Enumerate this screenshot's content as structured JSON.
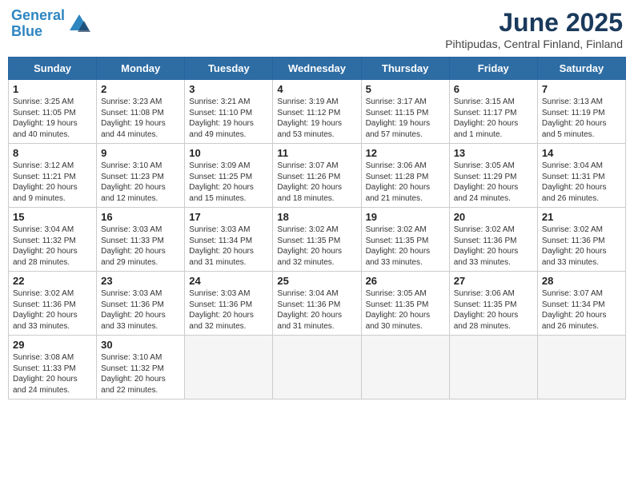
{
  "header": {
    "logo_line1": "General",
    "logo_line2": "Blue",
    "month_title": "June 2025",
    "subtitle": "Pihtipudas, Central Finland, Finland"
  },
  "weekdays": [
    "Sunday",
    "Monday",
    "Tuesday",
    "Wednesday",
    "Thursday",
    "Friday",
    "Saturday"
  ],
  "weeks": [
    [
      {
        "day": "1",
        "info": "Sunrise: 3:25 AM\nSunset: 11:05 PM\nDaylight: 19 hours\nand 40 minutes."
      },
      {
        "day": "2",
        "info": "Sunrise: 3:23 AM\nSunset: 11:08 PM\nDaylight: 19 hours\nand 44 minutes."
      },
      {
        "day": "3",
        "info": "Sunrise: 3:21 AM\nSunset: 11:10 PM\nDaylight: 19 hours\nand 49 minutes."
      },
      {
        "day": "4",
        "info": "Sunrise: 3:19 AM\nSunset: 11:12 PM\nDaylight: 19 hours\nand 53 minutes."
      },
      {
        "day": "5",
        "info": "Sunrise: 3:17 AM\nSunset: 11:15 PM\nDaylight: 19 hours\nand 57 minutes."
      },
      {
        "day": "6",
        "info": "Sunrise: 3:15 AM\nSunset: 11:17 PM\nDaylight: 20 hours\nand 1 minute."
      },
      {
        "day": "7",
        "info": "Sunrise: 3:13 AM\nSunset: 11:19 PM\nDaylight: 20 hours\nand 5 minutes."
      }
    ],
    [
      {
        "day": "8",
        "info": "Sunrise: 3:12 AM\nSunset: 11:21 PM\nDaylight: 20 hours\nand 9 minutes."
      },
      {
        "day": "9",
        "info": "Sunrise: 3:10 AM\nSunset: 11:23 PM\nDaylight: 20 hours\nand 12 minutes."
      },
      {
        "day": "10",
        "info": "Sunrise: 3:09 AM\nSunset: 11:25 PM\nDaylight: 20 hours\nand 15 minutes."
      },
      {
        "day": "11",
        "info": "Sunrise: 3:07 AM\nSunset: 11:26 PM\nDaylight: 20 hours\nand 18 minutes."
      },
      {
        "day": "12",
        "info": "Sunrise: 3:06 AM\nSunset: 11:28 PM\nDaylight: 20 hours\nand 21 minutes."
      },
      {
        "day": "13",
        "info": "Sunrise: 3:05 AM\nSunset: 11:29 PM\nDaylight: 20 hours\nand 24 minutes."
      },
      {
        "day": "14",
        "info": "Sunrise: 3:04 AM\nSunset: 11:31 PM\nDaylight: 20 hours\nand 26 minutes."
      }
    ],
    [
      {
        "day": "15",
        "info": "Sunrise: 3:04 AM\nSunset: 11:32 PM\nDaylight: 20 hours\nand 28 minutes."
      },
      {
        "day": "16",
        "info": "Sunrise: 3:03 AM\nSunset: 11:33 PM\nDaylight: 20 hours\nand 29 minutes."
      },
      {
        "day": "17",
        "info": "Sunrise: 3:03 AM\nSunset: 11:34 PM\nDaylight: 20 hours\nand 31 minutes."
      },
      {
        "day": "18",
        "info": "Sunrise: 3:02 AM\nSunset: 11:35 PM\nDaylight: 20 hours\nand 32 minutes."
      },
      {
        "day": "19",
        "info": "Sunrise: 3:02 AM\nSunset: 11:35 PM\nDaylight: 20 hours\nand 33 minutes."
      },
      {
        "day": "20",
        "info": "Sunrise: 3:02 AM\nSunset: 11:36 PM\nDaylight: 20 hours\nand 33 minutes."
      },
      {
        "day": "21",
        "info": "Sunrise: 3:02 AM\nSunset: 11:36 PM\nDaylight: 20 hours\nand 33 minutes."
      }
    ],
    [
      {
        "day": "22",
        "info": "Sunrise: 3:02 AM\nSunset: 11:36 PM\nDaylight: 20 hours\nand 33 minutes."
      },
      {
        "day": "23",
        "info": "Sunrise: 3:03 AM\nSunset: 11:36 PM\nDaylight: 20 hours\nand 33 minutes."
      },
      {
        "day": "24",
        "info": "Sunrise: 3:03 AM\nSunset: 11:36 PM\nDaylight: 20 hours\nand 32 minutes."
      },
      {
        "day": "25",
        "info": "Sunrise: 3:04 AM\nSunset: 11:36 PM\nDaylight: 20 hours\nand 31 minutes."
      },
      {
        "day": "26",
        "info": "Sunrise: 3:05 AM\nSunset: 11:35 PM\nDaylight: 20 hours\nand 30 minutes."
      },
      {
        "day": "27",
        "info": "Sunrise: 3:06 AM\nSunset: 11:35 PM\nDaylight: 20 hours\nand 28 minutes."
      },
      {
        "day": "28",
        "info": "Sunrise: 3:07 AM\nSunset: 11:34 PM\nDaylight: 20 hours\nand 26 minutes."
      }
    ],
    [
      {
        "day": "29",
        "info": "Sunrise: 3:08 AM\nSunset: 11:33 PM\nDaylight: 20 hours\nand 24 minutes."
      },
      {
        "day": "30",
        "info": "Sunrise: 3:10 AM\nSunset: 11:32 PM\nDaylight: 20 hours\nand 22 minutes."
      },
      {
        "day": "",
        "info": ""
      },
      {
        "day": "",
        "info": ""
      },
      {
        "day": "",
        "info": ""
      },
      {
        "day": "",
        "info": ""
      },
      {
        "day": "",
        "info": ""
      }
    ]
  ]
}
